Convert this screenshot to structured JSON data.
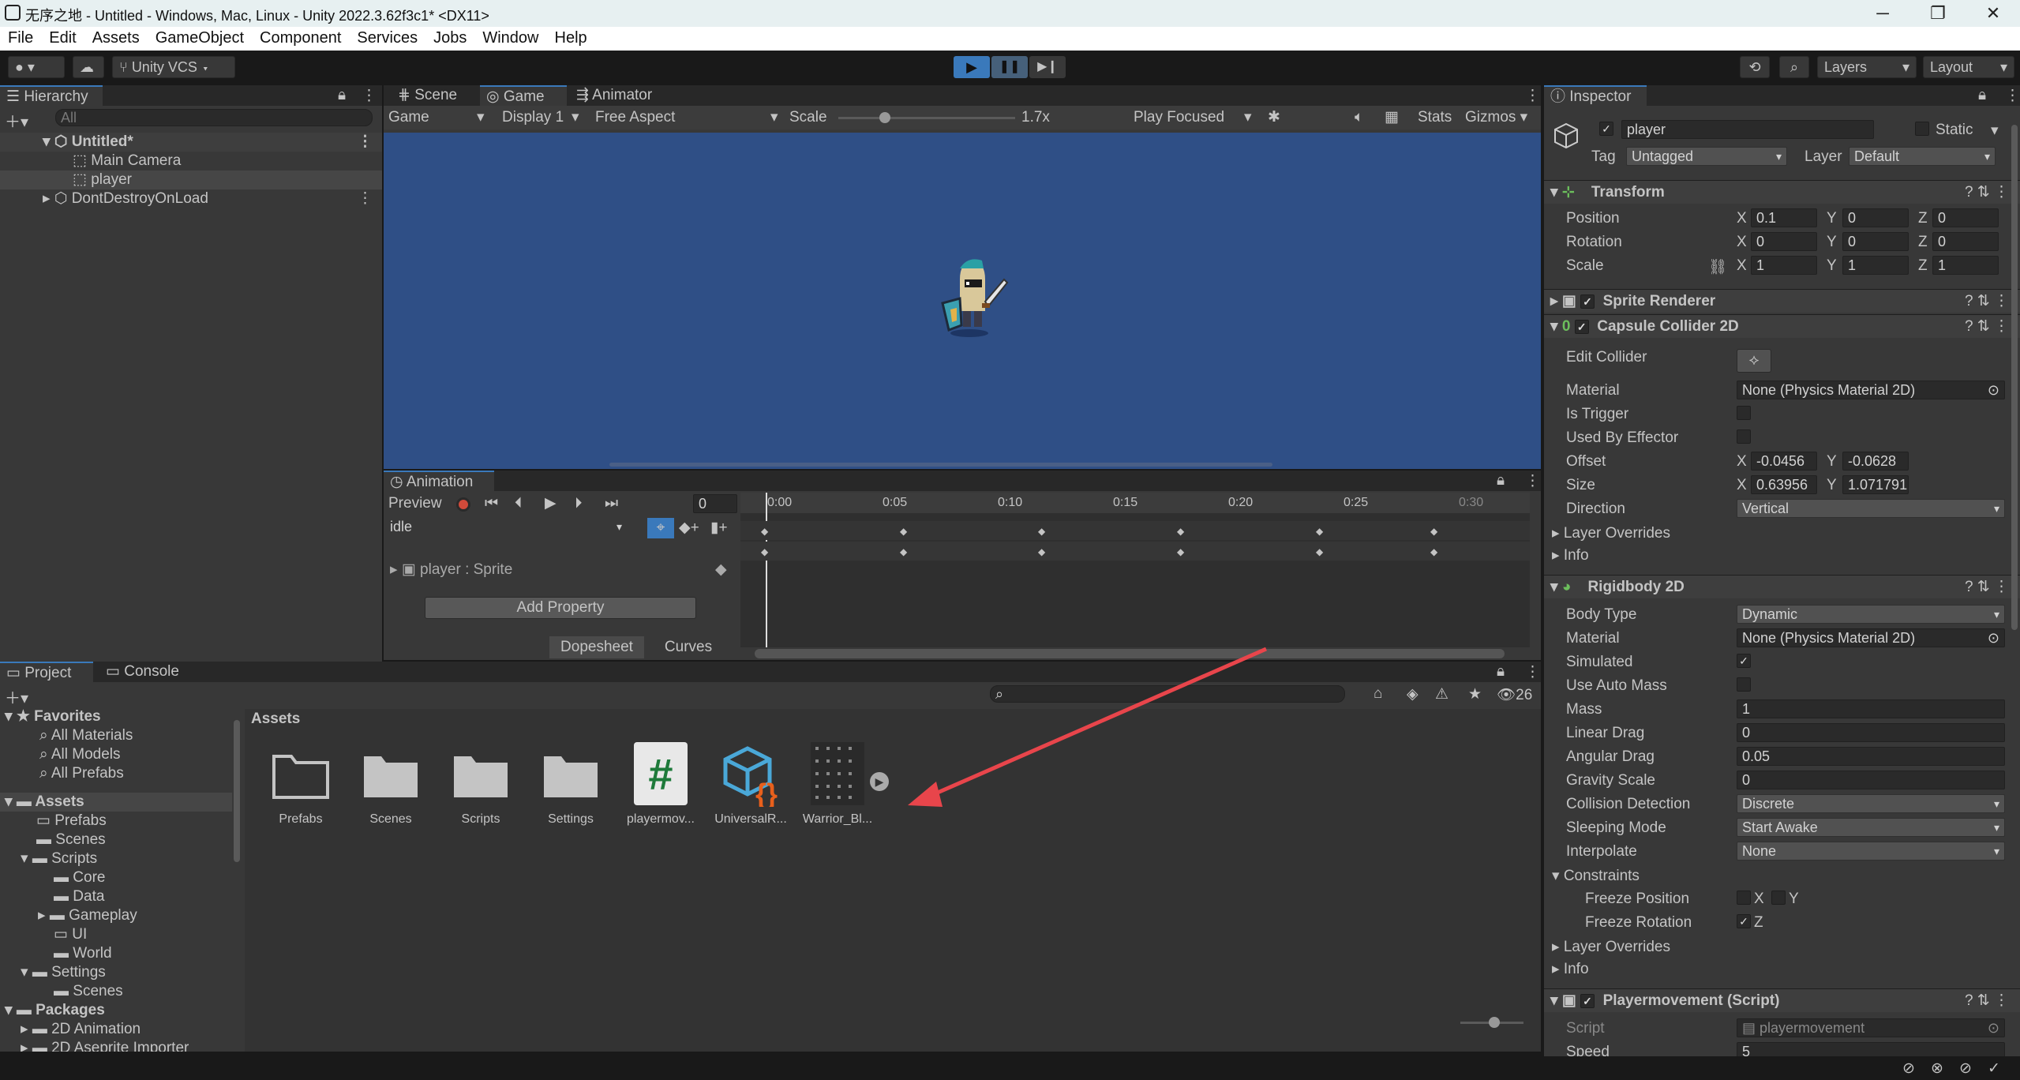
{
  "window": {
    "title": "无序之地 - Untitled - Windows, Mac, Linux - Unity 2022.3.62f3c1* <DX11>"
  },
  "menu": [
    "File",
    "Edit",
    "Assets",
    "GameObject",
    "Component",
    "Services",
    "Jobs",
    "Window",
    "Help"
  ],
  "toolbar": {
    "vcs": "Unity VCS",
    "layers": "Layers",
    "layout": "Layout"
  },
  "hierarchy": {
    "tab": "Hierarchy",
    "search_placeholder": "All",
    "scene": "Untitled*",
    "items": [
      "Main Camera",
      "player"
    ],
    "ddol": "DontDestroyOnLoad"
  },
  "center_tabs": [
    "Scene",
    "Game",
    "Animator"
  ],
  "game": {
    "mode": "Game",
    "display": "Display 1",
    "aspect": "Free Aspect",
    "scale_label": "Scale",
    "scale_value": "1.7x",
    "play_focused": "Play Focused",
    "stats": "Stats",
    "gizmos": "Gizmos"
  },
  "animation": {
    "tab": "Animation",
    "preview": "Preview",
    "frame": "0",
    "clip": "idle",
    "property": "player : Sprite",
    "add_property": "Add Property",
    "dopesheet": "Dopesheet",
    "curves": "Curves",
    "ticks": [
      "0:00",
      "0:05",
      "0:10",
      "0:15",
      "0:20",
      "0:25",
      "0:30"
    ]
  },
  "project": {
    "tabs": [
      "Project",
      "Console"
    ],
    "count": "26",
    "breadcrumb": "Assets",
    "favorites": {
      "label": "Favorites",
      "items": [
        "All Materials",
        "All Models",
        "All Prefabs"
      ]
    },
    "tree": {
      "assets": "Assets",
      "prefabs": "Prefabs",
      "scenes": "Scenes",
      "scripts": "Scripts",
      "core": "Core",
      "data": "Data",
      "gameplay": "Gameplay",
      "ui": "UI",
      "world": "World",
      "settings": "Settings",
      "settings_scenes": "Scenes",
      "packages": "Packages",
      "anim2d": "2D Animation",
      "more": "2D Aseprite Importer"
    },
    "tiles": [
      "Prefabs",
      "Scenes",
      "Scripts",
      "Settings",
      "playermov...",
      "UniversalR...",
      "Warrior_Bl..."
    ]
  },
  "inspector": {
    "tab": "Inspector",
    "name": "player",
    "static": "Static",
    "tag_label": "Tag",
    "tag": "Untagged",
    "layer_label": "Layer",
    "layer": "Default",
    "transform": {
      "title": "Transform",
      "position": "Position",
      "rotation": "Rotation",
      "scale": "Scale",
      "px": "0.1",
      "py": "0",
      "pz": "0",
      "rx": "0",
      "ry": "0",
      "rz": "0",
      "sx": "1",
      "sy": "1",
      "sz": "1"
    },
    "sprite_renderer": "Sprite Renderer",
    "capsule": {
      "title": "Capsule Collider 2D",
      "edit_collider": "Edit Collider",
      "material": "Material",
      "material_value": "None (Physics Material 2D)",
      "is_trigger": "Is Trigger",
      "used_by_effector": "Used By Effector",
      "offset": "Offset",
      "ox": "-0.0456",
      "oy": "-0.0628",
      "size": "Size",
      "sx": "0.63956",
      "sy": "1.071791",
      "direction": "Direction",
      "direction_value": "Vertical",
      "layer_overrides": "Layer Overrides",
      "info": "Info"
    },
    "rigidbody": {
      "title": "Rigidbody 2D",
      "body_type": "Body Type",
      "body_type_value": "Dynamic",
      "material": "Material",
      "material_value": "None (Physics Material 2D)",
      "simulated": "Simulated",
      "use_auto_mass": "Use Auto Mass",
      "mass": "Mass",
      "mass_value": "1",
      "linear_drag": "Linear Drag",
      "linear_drag_value": "0",
      "angular_drag": "Angular Drag",
      "angular_drag_value": "0.05",
      "gravity_scale": "Gravity Scale",
      "gravity_scale_value": "0",
      "collision_detection": "Collision Detection",
      "collision_detection_value": "Discrete",
      "sleeping_mode": "Sleeping Mode",
      "sleeping_mode_value": "Start Awake",
      "interpolate": "Interpolate",
      "interpolate_value": "None",
      "constraints": "Constraints",
      "freeze_position": "Freeze Position",
      "freeze_rotation": "Freeze Rotation",
      "x": "X",
      "y": "Y",
      "z": "Z",
      "layer_overrides": "Layer Overrides",
      "info": "Info"
    },
    "script": {
      "title": "Playermovement (Script)",
      "script_label": "Script",
      "script_value": "playermovement",
      "speed": "Speed",
      "speed_value": "5"
    }
  },
  "colors": {
    "accent": "#3a79bb",
    "arrow": "#e8454b",
    "game_bg": "#2f4f86"
  }
}
